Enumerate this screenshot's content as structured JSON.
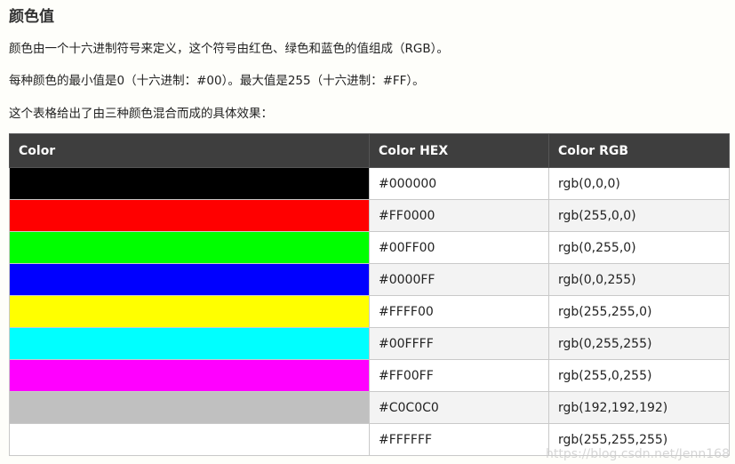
{
  "heading": "颜色值",
  "paragraphs": [
    "颜色由一个十六进制符号来定义，这个符号由红色、绿色和蓝色的值组成（RGB）。",
    "每种颜色的最小值是0（十六进制：#00）。最大值是255（十六进制：#FF）。",
    "这个表格给出了由三种颜色混合而成的具体效果："
  ],
  "table": {
    "headers": [
      "Color",
      "Color HEX",
      "Color RGB"
    ],
    "rows": [
      {
        "swatch": "#000000",
        "hex": "#000000",
        "rgb": "rgb(0,0,0)"
      },
      {
        "swatch": "#FF0000",
        "hex": "#FF0000",
        "rgb": "rgb(255,0,0)"
      },
      {
        "swatch": "#00FF00",
        "hex": "#00FF00",
        "rgb": "rgb(0,255,0)"
      },
      {
        "swatch": "#0000FF",
        "hex": "#0000FF",
        "rgb": "rgb(0,0,255)"
      },
      {
        "swatch": "#FFFF00",
        "hex": "#FFFF00",
        "rgb": "rgb(255,255,0)"
      },
      {
        "swatch": "#00FFFF",
        "hex": "#00FFFF",
        "rgb": "rgb(0,255,255)"
      },
      {
        "swatch": "#FF00FF",
        "hex": "#FF00FF",
        "rgb": "rgb(255,0,255)"
      },
      {
        "swatch": "#C0C0C0",
        "hex": "#C0C0C0",
        "rgb": "rgb(192,192,192)"
      },
      {
        "swatch": "#FFFFFF",
        "hex": "#FFFFFF",
        "rgb": "rgb(255,255,255)"
      }
    ]
  },
  "watermark": "https://blog.csdn.net/Jenn168"
}
